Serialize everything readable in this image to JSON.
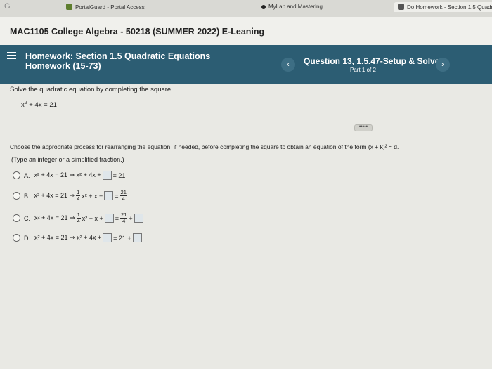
{
  "browser": {
    "first_tab_glyph": "G",
    "tabs": [
      {
        "label": "PortalGuard - Portal Access"
      },
      {
        "label": "MyLab and Mastering"
      },
      {
        "label": "Do Homework - Section 1.5 Quadr"
      }
    ]
  },
  "course": {
    "title": "MAC1105 College Algebra - 50218 (SUMMER 2022) E-Leaning"
  },
  "homework": {
    "title": "Homework:  Section 1.5 Quadratic Equations",
    "subtitle": "Homework (15-73)",
    "question_title": "Question 13, 1.5.47-Setup & Solve",
    "part": "Part 1 of 2",
    "prev_icon": "‹",
    "next_icon": "›",
    "band_color": "#2c5d73"
  },
  "problem": {
    "instruction": "Solve the quadratic equation by completing the square.",
    "equation_base": "x",
    "equation_exp": "2",
    "equation_rest": " + 4x = 21",
    "more_label": "•••••",
    "choose_text": "Choose the appropriate process for rearranging the equation, if needed, before completing the square to obtain an equation of the form (x + k)² = d.",
    "hint": "(Type an integer or a simplified fraction.)"
  },
  "options": {
    "a": {
      "letter": "A.",
      "lhs": "x² + 4x = 21 ⇒ x² + 4x +",
      "rhs": "= 21"
    },
    "b": {
      "letter": "B.",
      "lhs": "x² + 4x = 21 ⇒",
      "frac1_num": "1",
      "frac1_den": "4",
      "mid": "x² + x +",
      "eq": "=",
      "frac2_num": "21",
      "frac2_den": "4"
    },
    "c": {
      "letter": "C.",
      "lhs": "x² + 4x = 21 ⇒",
      "frac1_num": "1",
      "frac1_den": "4",
      "mid": "x² + x +",
      "eq": "=",
      "frac2_num": "21",
      "frac2_den": "4",
      "plus": "+"
    },
    "d": {
      "letter": "D.",
      "lhs": "x² + 4x = 21 ⇒ x² + 4x +",
      "rhs": "= 21 +"
    }
  }
}
